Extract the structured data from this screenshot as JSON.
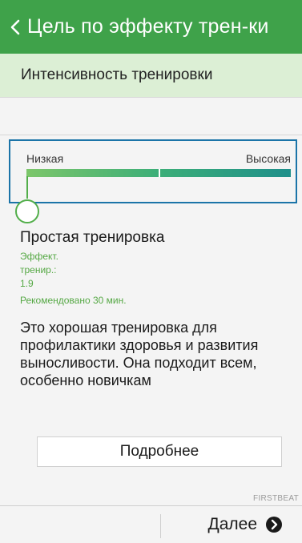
{
  "header": {
    "title": "Цель по эффекту трен-ки",
    "back_icon": "chevron-left-icon",
    "background": "#3fa24a"
  },
  "subheader": {
    "label": "Интенсивность тренировки",
    "background": "#dcefd5"
  },
  "intensity_slider": {
    "low_label": "Низкая",
    "high_label": "Высокая",
    "level": 0.0
  },
  "info": {
    "title": "Простая тренировка",
    "effect_line1": "Эффект.",
    "effect_line2": "тренир.:",
    "effect_value": "1.9",
    "recommended": "Рекомендовано 30 мин.",
    "description": "Это хорошая тренировка для профилактики здоровья и развития выносливости. Она подходит всем, особенно новичкам"
  },
  "details_button": {
    "label": "Подробнее"
  },
  "brand": "FIRSTBEAT",
  "footer": {
    "next_label": "Далее",
    "next_icon": "arrow-right-circle-icon"
  },
  "colors": {
    "accent_green": "#55a844",
    "focus_border": "#1b74a8"
  }
}
